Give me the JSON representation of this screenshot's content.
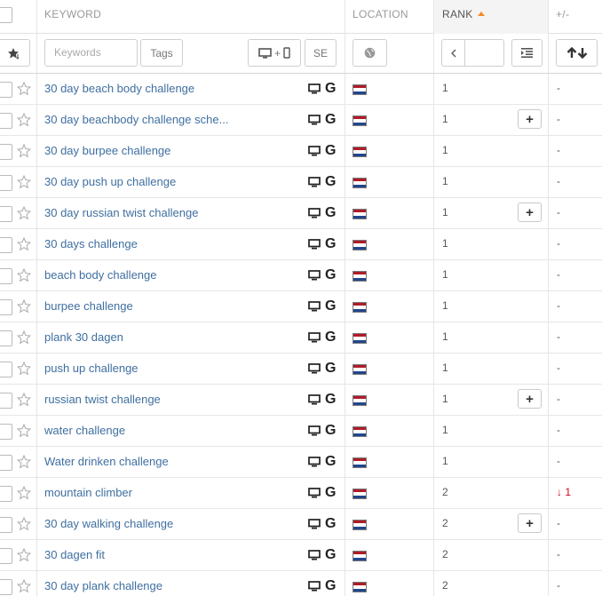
{
  "header": {
    "keyword": "KEYWORD",
    "location": "LOCATION",
    "rank": "RANK",
    "change": "+/-"
  },
  "filters": {
    "keywords_placeholder": "Keywords",
    "tags_label": "Tags",
    "device_label": "+",
    "se_label": "SE",
    "globe_icon": "globe-icon",
    "prev_icon": "chevron-left-icon",
    "list_icon": "list-indent-icon",
    "sort_icon": "sort-up-down-icon"
  },
  "colors": {
    "accent": "#f28c28",
    "link": "#3f6fa0",
    "down": "#d0021b",
    "flag_red": "#ae1c28",
    "flag_white": "#ffffff",
    "flag_blue": "#21468b"
  },
  "rows": [
    {
      "keyword": "30 day beach body challenge",
      "rank": "1",
      "change": "-",
      "plus": false,
      "engine": "G"
    },
    {
      "keyword": "30 day beachbody challenge sche...",
      "rank": "1",
      "change": "-",
      "plus": true,
      "engine": "G"
    },
    {
      "keyword": "30 day burpee challenge",
      "rank": "1",
      "change": "-",
      "plus": false,
      "engine": "G"
    },
    {
      "keyword": "30 day push up challenge",
      "rank": "1",
      "change": "-",
      "plus": false,
      "engine": "G"
    },
    {
      "keyword": "30 day russian twist challenge",
      "rank": "1",
      "change": "-",
      "plus": true,
      "engine": "G"
    },
    {
      "keyword": "30 days challenge",
      "rank": "1",
      "change": "-",
      "plus": false,
      "engine": "G"
    },
    {
      "keyword": "beach body challenge",
      "rank": "1",
      "change": "-",
      "plus": false,
      "engine": "G"
    },
    {
      "keyword": "burpee challenge",
      "rank": "1",
      "change": "-",
      "plus": false,
      "engine": "G"
    },
    {
      "keyword": "plank 30 dagen",
      "rank": "1",
      "change": "-",
      "plus": false,
      "engine": "G"
    },
    {
      "keyword": "push up challenge",
      "rank": "1",
      "change": "-",
      "plus": false,
      "engine": "G"
    },
    {
      "keyword": "russian twist challenge",
      "rank": "1",
      "change": "-",
      "plus": true,
      "engine": "G"
    },
    {
      "keyword": "water challenge",
      "rank": "1",
      "change": "-",
      "plus": false,
      "engine": "G"
    },
    {
      "keyword": "Water drinken challenge",
      "rank": "1",
      "change": "-",
      "plus": false,
      "engine": "G"
    },
    {
      "keyword": "mountain climber",
      "rank": "2",
      "change": "↓ 1",
      "plus": false,
      "down": true,
      "engine": "G"
    },
    {
      "keyword": "30 day walking challenge",
      "rank": "2",
      "change": "-",
      "plus": true,
      "engine": "G"
    },
    {
      "keyword": "30 dagen fit",
      "rank": "2",
      "change": "-",
      "plus": false,
      "engine": "G"
    },
    {
      "keyword": "30 day plank challenge",
      "rank": "2",
      "change": "-",
      "plus": false,
      "engine": "G"
    }
  ]
}
